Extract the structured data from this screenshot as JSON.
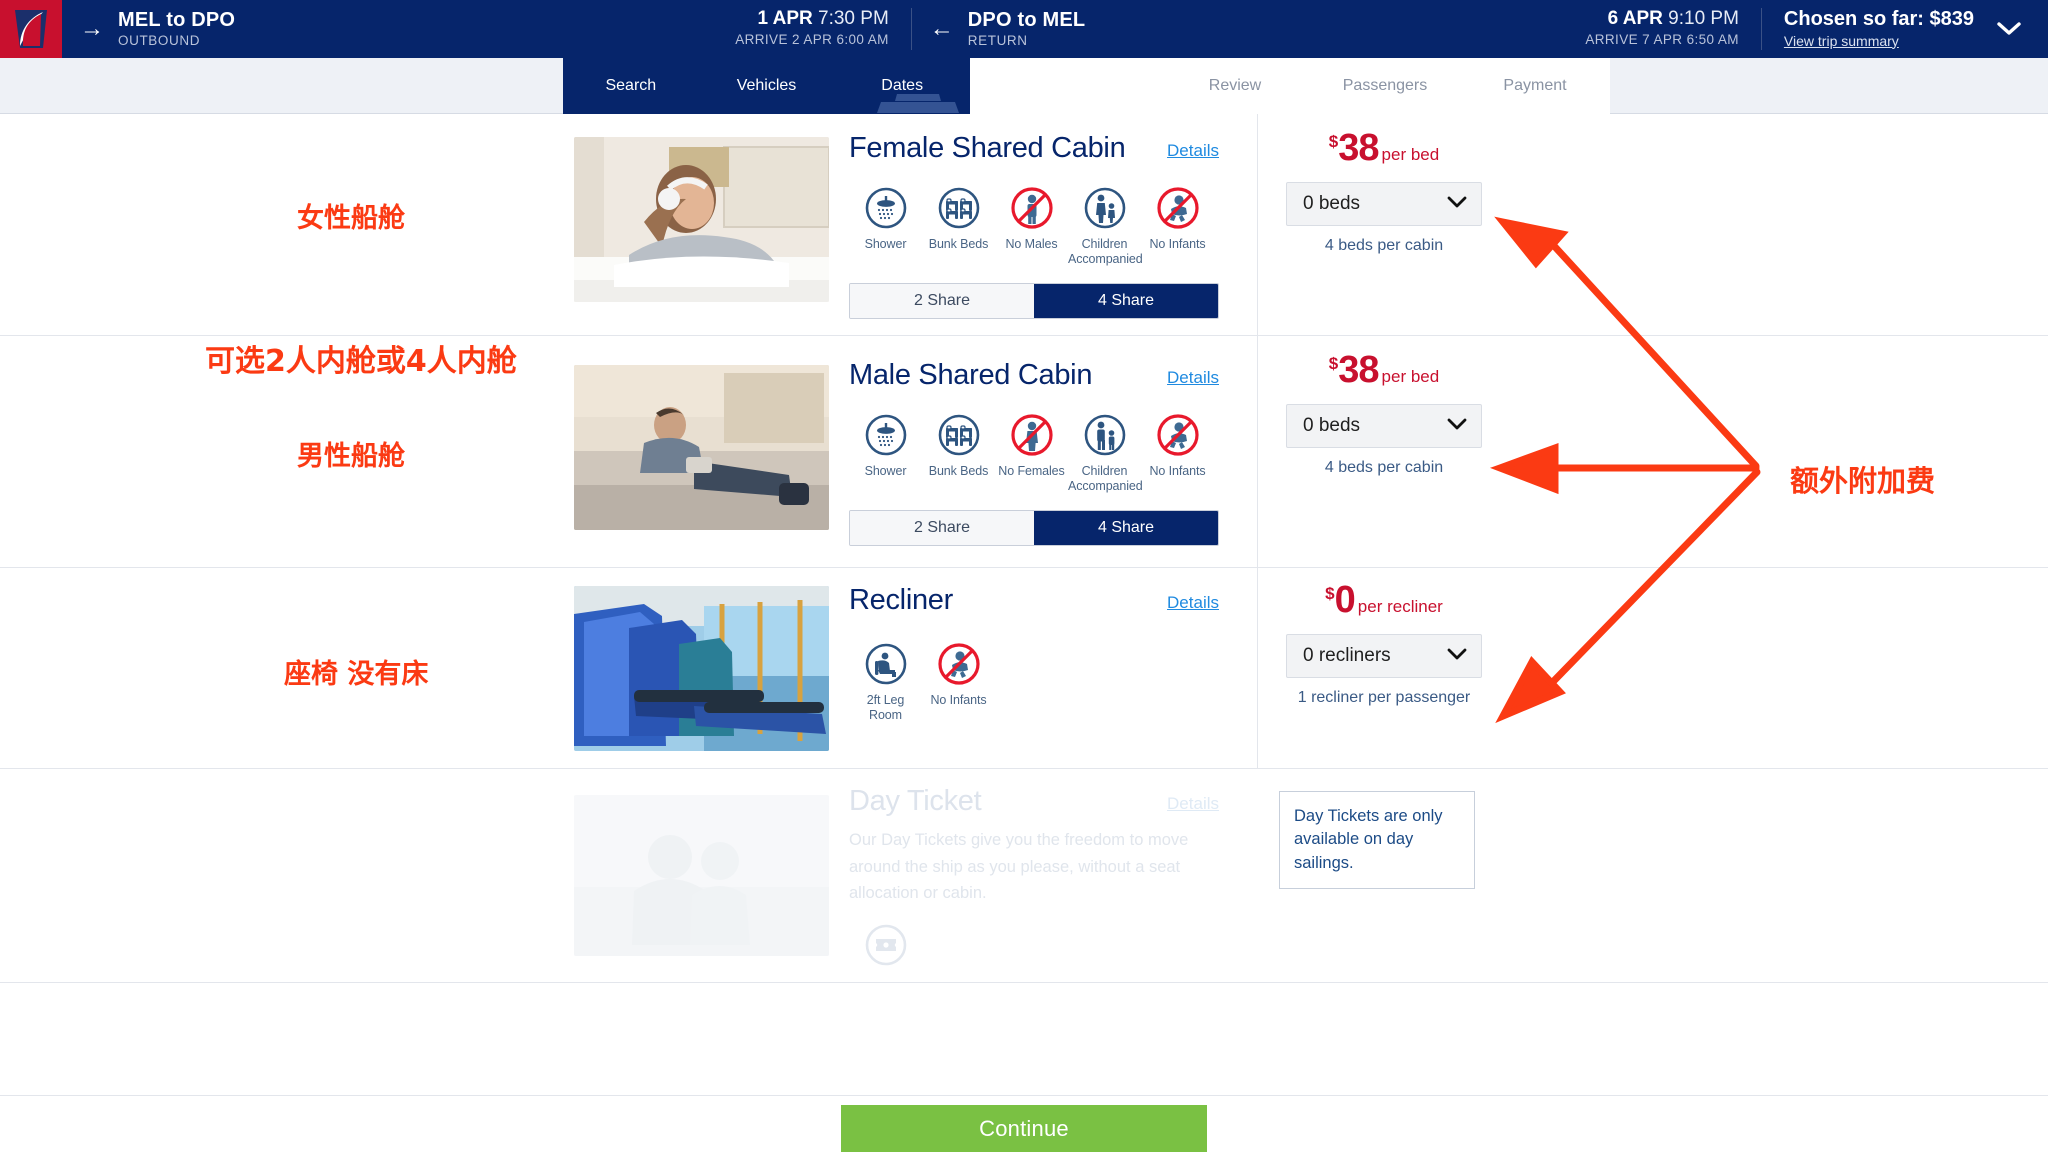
{
  "header": {
    "logo_alt": "spirit-of-tasmania-logo",
    "outbound": {
      "arrow": "→",
      "route": "MEL to DPO",
      "direction": "OUTBOUND",
      "depart_date": "1 APR",
      "depart_time": "7:30 PM",
      "arrive": "ARRIVE 2 APR 6:00 AM"
    },
    "return": {
      "arrow": "←",
      "route": "DPO to MEL",
      "direction": "RETURN",
      "depart_date": "6 APR",
      "depart_time": "9:10 PM",
      "arrive": "ARRIVE 7 APR 6:50 AM"
    },
    "chosen_label": "Chosen so far: $839",
    "trip_summary_link": "View trip summary"
  },
  "stepnav": {
    "active_steps": [
      "Search",
      "Vehicles",
      "Dates"
    ],
    "inactive_steps": [
      "Review",
      "Passengers",
      "Payment"
    ],
    "current": "Dates"
  },
  "accommodations": [
    {
      "id": "female-shared-cabin",
      "title": "Female Shared Cabin",
      "details_label": "Details",
      "thumb_alt": "woman-with-headphones-in-cabin-photo",
      "amenities": [
        {
          "icon": "shower-icon",
          "label": "Shower",
          "restricted": false
        },
        {
          "icon": "bunk-beds-icon",
          "label": "Bunk Beds",
          "restricted": false
        },
        {
          "icon": "no-males-icon",
          "label": "No Males",
          "restricted": true
        },
        {
          "icon": "children-accompanied-icon",
          "label": "Children Accompanied",
          "restricted": false
        },
        {
          "icon": "no-infants-icon",
          "label": "No Infants",
          "restricted": true
        }
      ],
      "share_options": [
        {
          "label": "2 Share",
          "selected": false
        },
        {
          "label": "4 Share",
          "selected": true
        }
      ],
      "price_currency": "$",
      "price_amount": "38",
      "price_unit": "per bed",
      "select_value": "0 beds",
      "hint": "4 beds per cabin"
    },
    {
      "id": "male-shared-cabin",
      "title": "Male Shared Cabin",
      "details_label": "Details",
      "thumb_alt": "man-relaxing-in-cabin-photo",
      "amenities": [
        {
          "icon": "shower-icon",
          "label": "Shower",
          "restricted": false
        },
        {
          "icon": "bunk-beds-icon",
          "label": "Bunk Beds",
          "restricted": false
        },
        {
          "icon": "no-females-icon",
          "label": "No Females",
          "restricted": true
        },
        {
          "icon": "children-accompanied-icon",
          "label": "Children Accompanied",
          "restricted": false
        },
        {
          "icon": "no-infants-icon",
          "label": "No Infants",
          "restricted": true
        }
      ],
      "share_options": [
        {
          "label": "2 Share",
          "selected": false
        },
        {
          "label": "4 Share",
          "selected": true
        }
      ],
      "price_currency": "$",
      "price_amount": "38",
      "price_unit": "per bed",
      "select_value": "0 beds",
      "hint": "4 beds per cabin"
    },
    {
      "id": "recliner",
      "title": "Recliner",
      "details_label": "Details",
      "thumb_alt": "blue-recliner-seats-by-window-photo",
      "amenities": [
        {
          "icon": "leg-room-icon",
          "label": "2ft Leg Room",
          "restricted": false
        },
        {
          "icon": "no-infants-icon",
          "label": "No Infants",
          "restricted": true
        }
      ],
      "share_options": [],
      "price_currency": "$",
      "price_amount": "0",
      "price_unit": "per recliner",
      "select_value": "0 recliners",
      "hint": "1 recliner per passenger"
    }
  ],
  "day_ticket": {
    "id": "day-ticket",
    "title": "Day Ticket",
    "details_label": "Details",
    "description": "Our Day Tickets give you the freedom to move around the ship as you please, without a seat allocation or cabin.",
    "icon": "ticket-icon",
    "thumb_alt": "family-on-deck-photo",
    "note": "Day Tickets are only available on day sailings."
  },
  "footer": {
    "continue_label": "Continue"
  },
  "annotations": {
    "color": "#fb3a13",
    "notes": [
      {
        "id": "note-female-cabin",
        "text": "女性船舱"
      },
      {
        "id": "note-share-options",
        "text": "可选2人内舱或4人内舱"
      },
      {
        "id": "note-male-cabin",
        "text": "男性船舱"
      },
      {
        "id": "note-recliner",
        "text": "座椅 没有床"
      },
      {
        "id": "note-surcharge",
        "text": "额外附加费"
      }
    ]
  }
}
